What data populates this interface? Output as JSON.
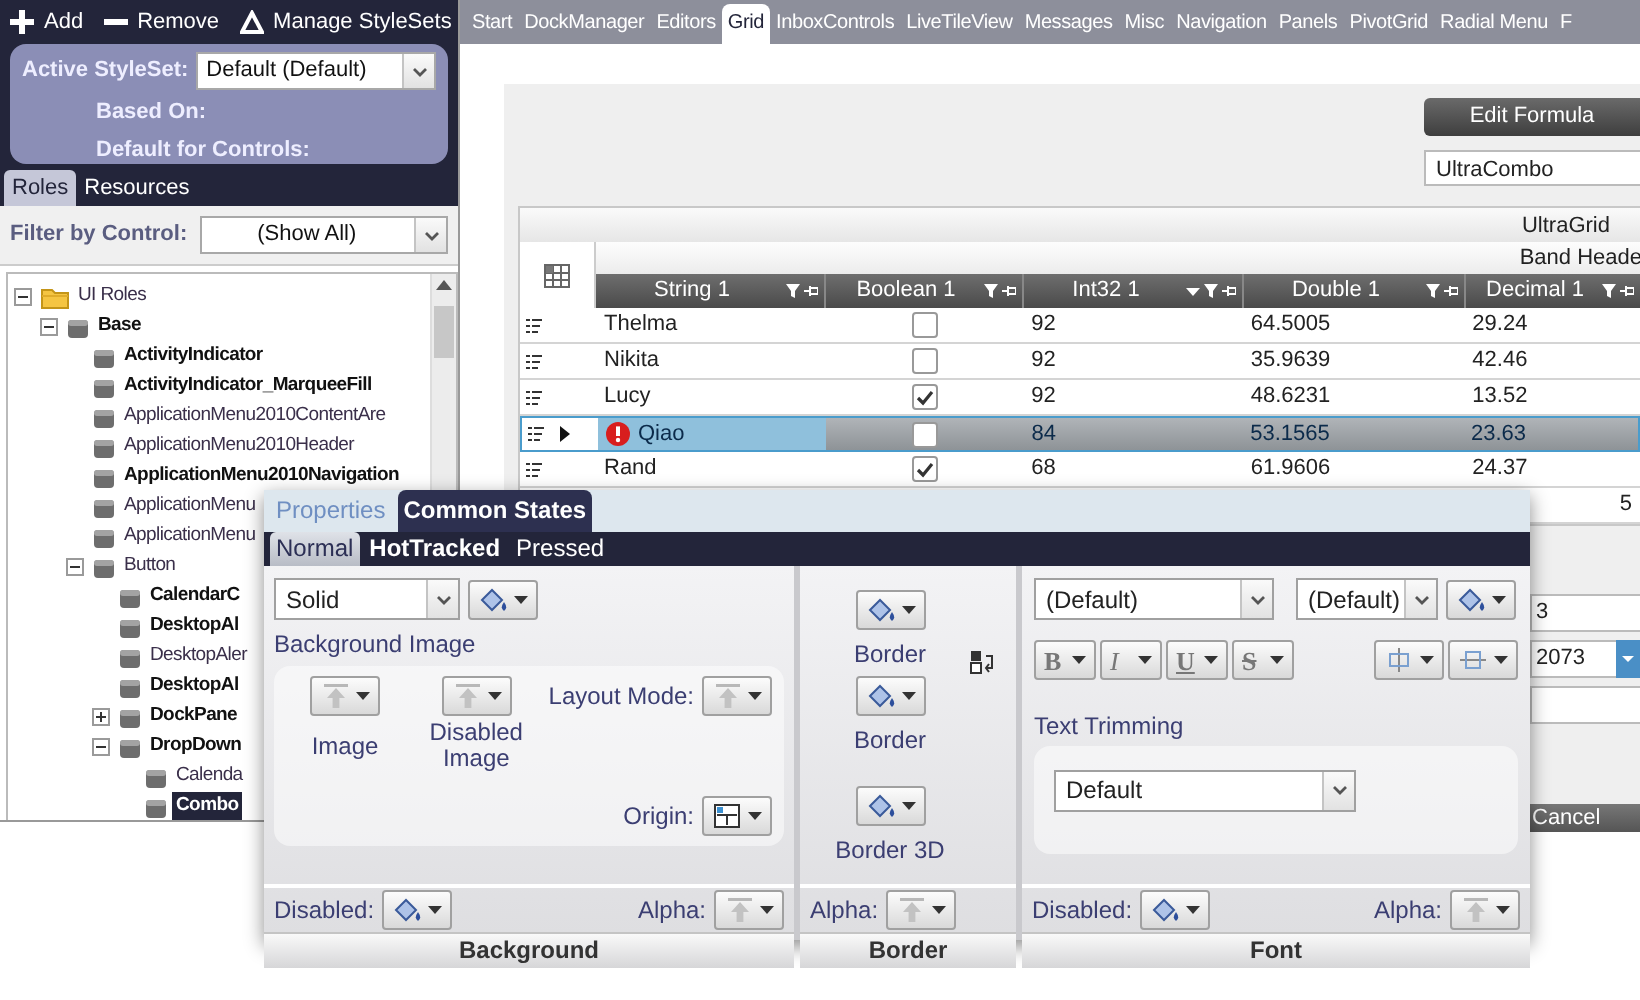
{
  "style_toolbar": [
    "Add",
    "Remove",
    "Manage StyleSets"
  ],
  "styleset_panel": {
    "active_label": "Active StyleSet:",
    "active_value": "Default (Default)",
    "based_on_label": "Based On:",
    "default_for_label": "Default for Controls:"
  },
  "left_tabs": [
    {
      "label": "Roles",
      "selected": true
    },
    {
      "label": "Resources",
      "selected": false
    }
  ],
  "filter": {
    "label": "Filter by Control:",
    "value": "(Show All)"
  },
  "role_tree": [
    {
      "label": "UI Roles",
      "kind": "folder",
      "expanded": true,
      "emphasized": false,
      "selected": false,
      "children": [
        {
          "label": "Base",
          "kind": "group",
          "expanded": true,
          "emphasized": true,
          "selected": false,
          "children": [
            {
              "label": "ActivityIndicator",
              "kind": "role",
              "emphasized": true,
              "selected": false
            },
            {
              "label": "ActivityIndicator_MarqueeFill",
              "kind": "role",
              "emphasized": true,
              "selected": false
            },
            {
              "label": "ApplicationMenu2010ContentAre",
              "kind": "role",
              "emphasized": false,
              "selected": false
            },
            {
              "label": "ApplicationMenu2010Header",
              "kind": "role",
              "emphasized": false,
              "selected": false
            },
            {
              "label": "ApplicationMenu2010Navigation",
              "kind": "role",
              "emphasized": true,
              "selected": false
            },
            {
              "label": "ApplicationMenu",
              "kind": "role",
              "emphasized": false,
              "selected": false
            },
            {
              "label": "ApplicationMenu",
              "kind": "role",
              "emphasized": false,
              "selected": false
            },
            {
              "label": "Button",
              "kind": "group",
              "expanded": true,
              "emphasized": false,
              "selected": false,
              "children": [
                {
                  "label": "CalendarC",
                  "kind": "role",
                  "emphasized": true,
                  "selected": false
                },
                {
                  "label": "DesktopAl",
                  "kind": "role",
                  "emphasized": true,
                  "selected": false
                },
                {
                  "label": "DesktopAler",
                  "kind": "role",
                  "emphasized": false,
                  "selected": false
                },
                {
                  "label": "DesktopAl",
                  "kind": "role",
                  "emphasized": true,
                  "selected": false
                },
                {
                  "label": "DockPane",
                  "kind": "group",
                  "expanded": false,
                  "emphasized": true,
                  "selected": false
                },
                {
                  "label": "DropDown",
                  "kind": "group",
                  "expanded": true,
                  "emphasized": true,
                  "selected": false,
                  "children": [
                    {
                      "label": "Calenda",
                      "kind": "role",
                      "emphasized": false,
                      "selected": false
                    },
                    {
                      "label": "Combo",
                      "kind": "role",
                      "emphasized": true,
                      "selected": true
                    }
                  ]
                }
              ]
            }
          ]
        }
      ]
    }
  ],
  "main_tabs": [
    {
      "label": "Start",
      "selected": false
    },
    {
      "label": "DockManager",
      "selected": false
    },
    {
      "label": "Editors",
      "selected": false
    },
    {
      "label": "Grid",
      "selected": true
    },
    {
      "label": "InboxControls",
      "selected": false
    },
    {
      "label": "LiveTileView",
      "selected": false
    },
    {
      "label": "Messages",
      "selected": false
    },
    {
      "label": "Misc",
      "selected": false
    },
    {
      "label": "Navigation",
      "selected": false
    },
    {
      "label": "Panels",
      "selected": false
    },
    {
      "label": "PivotGrid",
      "selected": false
    },
    {
      "label": "Radial Menu",
      "selected": false
    },
    {
      "label": "F",
      "selected": false
    }
  ],
  "edit_formula_button": "Edit Formula",
  "combo_value": "UltraCombo",
  "grid": {
    "caption": "UltraGrid",
    "band_header": "Band Heade",
    "columns": [
      {
        "label": "String 1",
        "sorted": false
      },
      {
        "label": "Boolean 1",
        "sorted": false
      },
      {
        "label": "Int32 1",
        "sorted": true
      },
      {
        "label": "Double 1",
        "sorted": false
      },
      {
        "label": "Decimal 1",
        "sorted": false
      }
    ],
    "rows": [
      {
        "cells": [
          "Thelma",
          "92",
          "64.5005",
          "29.24"
        ],
        "checked": false,
        "selected": false,
        "error": false
      },
      {
        "cells": [
          "Nikita",
          "92",
          "35.9639",
          "42.46"
        ],
        "checked": false,
        "selected": false,
        "error": false
      },
      {
        "cells": [
          "Lucy",
          "92",
          "48.6231",
          "13.52"
        ],
        "checked": true,
        "selected": false,
        "error": false
      },
      {
        "cells": [
          "Qiao",
          "84",
          "53.1565",
          "23.63"
        ],
        "checked": false,
        "selected": true,
        "error": true
      },
      {
        "cells": [
          "Rand",
          "68",
          "61.9606",
          "24.37"
        ],
        "checked": true,
        "selected": false,
        "error": false
      }
    ],
    "last_row_decimal": "5"
  },
  "side_fields": [
    "3",
    "2073"
  ],
  "cancel_button": "Cancel",
  "style_editor": {
    "tabs": [
      {
        "label": "Properties",
        "selected": false
      },
      {
        "label": "Common States",
        "selected": true
      }
    ],
    "state_tabs": [
      {
        "label": "Normal",
        "selected": true,
        "emphasized": false
      },
      {
        "label": "HotTracked",
        "selected": false,
        "emphasized": true
      },
      {
        "label": "Pressed",
        "selected": false,
        "emphasized": false
      }
    ],
    "background": {
      "title": "Background",
      "fill_value": "Solid",
      "image_heading": "Background Image",
      "image_label": "Image",
      "disabled_image_label": "Disabled Image",
      "layout_mode_label": "Layout Mode:",
      "origin_label": "Origin:",
      "disabled_label": "Disabled:",
      "alpha_label": "Alpha:"
    },
    "border": {
      "title": "Border",
      "labels": [
        "Border",
        "Border",
        "Border 3D"
      ],
      "alpha_label": "Alpha:"
    },
    "font": {
      "title": "Font",
      "family_value": "(Default)",
      "size_value": "(Default)",
      "style_buttons": [
        {
          "label": "B",
          "kind": "bold"
        },
        {
          "label": "I",
          "kind": "italic"
        },
        {
          "label": "U",
          "kind": "underline"
        },
        {
          "label": "S",
          "kind": "strikethrough"
        }
      ],
      "text_trimming_label": "Text Trimming",
      "text_trimming_value": "Default",
      "disabled_label": "Disabled:",
      "alpha_label": "Alpha:"
    }
  }
}
